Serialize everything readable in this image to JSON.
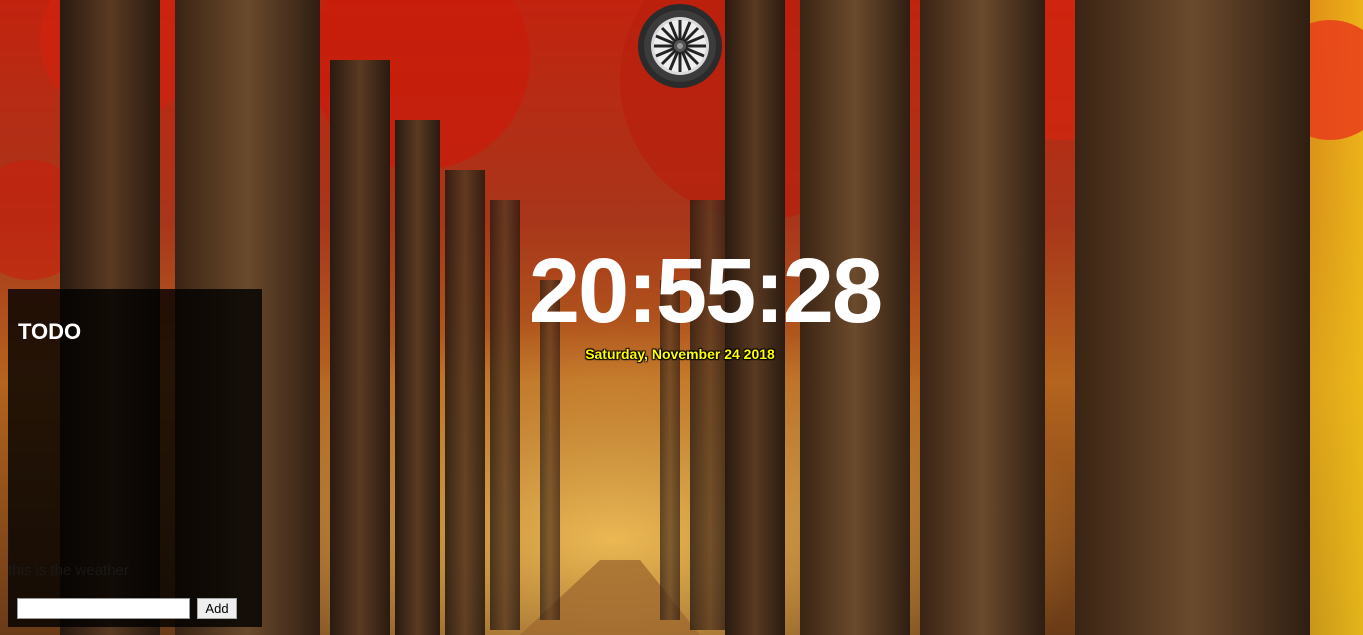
{
  "clock": {
    "time": "20:55:28"
  },
  "date": {
    "text": "Saturday, November 24 2018"
  },
  "todo": {
    "title": "TODO",
    "input_value": "",
    "input_placeholder": "",
    "add_label": "Add"
  },
  "weather": {
    "text": "this is the weather"
  },
  "logo": {
    "icon": "wheel-icon"
  },
  "colors": {
    "clock_text": "#ffffff",
    "date_text": "#ffff00",
    "panel_bg": "#000000"
  }
}
